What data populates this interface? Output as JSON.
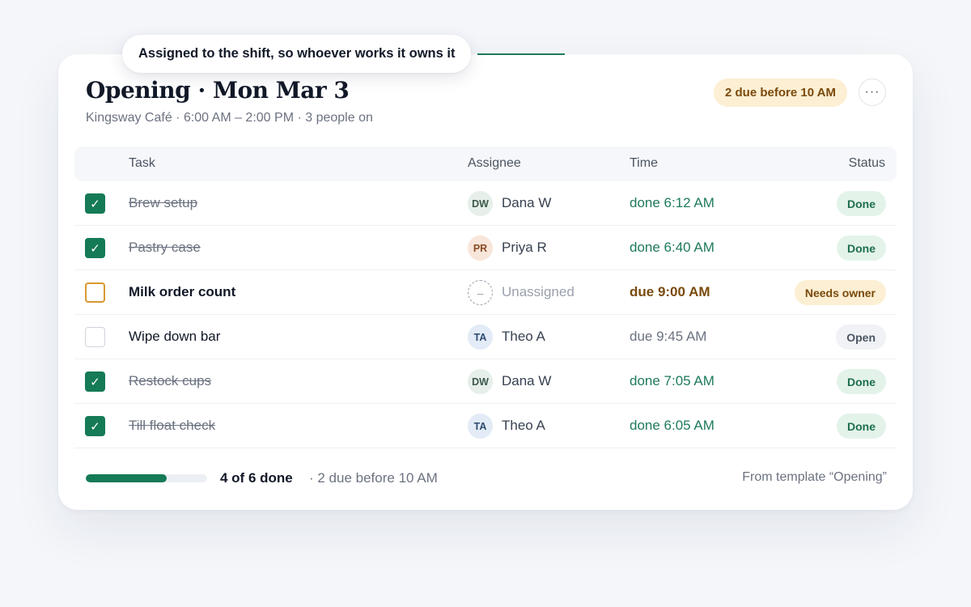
{
  "tooltip": {
    "text": "Assigned to the shift, so whoever works it owns it"
  },
  "header": {
    "title": "Opening · Mon Mar 3",
    "subtitle": "Kingsway Café · 6:00 AM – 2:00 PM · 3 people on",
    "due_badge": "2 due before 10 AM",
    "more_icon": "more-horizontal-icon",
    "more_glyph": "···"
  },
  "table": {
    "columns": {
      "task": "Task",
      "assignee": "Assignee",
      "time": "Time",
      "status": "Status"
    },
    "rows": [
      {
        "task": "Brew setup",
        "checked": true,
        "state": "done",
        "initials": "DW",
        "assignee": "Dana W",
        "avatar_bg": "#e6efe9",
        "avatar_fg": "#3d5a4c",
        "time": "done 6:12 AM",
        "status": "Done"
      },
      {
        "task": "Pastry case",
        "checked": true,
        "state": "done",
        "initials": "PR",
        "assignee": "Priya R",
        "avatar_bg": "#f8e6da",
        "avatar_fg": "#8a4a22",
        "time": "done 6:40 AM",
        "status": "Done"
      },
      {
        "task": "Milk order count",
        "checked": false,
        "state": "needs-owner",
        "initials": "–",
        "assignee": "Unassigned",
        "avatar_bg": "#ffffff",
        "avatar_fg": "#9aa1ad",
        "time": "due 9:00 AM",
        "status": "Needs owner"
      },
      {
        "task": "Wipe down bar",
        "checked": false,
        "state": "open",
        "initials": "TA",
        "assignee": "Theo A",
        "avatar_bg": "#e2ebf6",
        "avatar_fg": "#2f4a6e",
        "time": "due 9:45 AM",
        "status": "Open"
      },
      {
        "task": "Restock cups",
        "checked": true,
        "state": "done",
        "initials": "DW",
        "assignee": "Dana W",
        "avatar_bg": "#e6efe9",
        "avatar_fg": "#3d5a4c",
        "time": "done 7:05 AM",
        "status": "Done"
      },
      {
        "task": "Till float check",
        "checked": true,
        "state": "done",
        "initials": "TA",
        "assignee": "Theo A",
        "avatar_bg": "#e2ebf6",
        "avatar_fg": "#2f4a6e",
        "time": "done 6:05 AM",
        "status": "Done"
      }
    ]
  },
  "footer": {
    "progress_fraction": 0.667,
    "done_count": "4 of 6 done",
    "due_note": "· 2 due before 10 AM",
    "template_note": "From template “Opening”"
  },
  "colors": {
    "accent": "#157a56",
    "done_text": "#1e7a5a",
    "done_badge_bg": "#e3f3ea",
    "done_badge_fg": "#1e6e4e",
    "warn_badge_bg": "#fcefd3",
    "warn_badge_fg": "#7a4a0c",
    "warn_time": "#7a4a0c",
    "open_badge_bg": "#f0f2f5",
    "open_badge_fg": "#4b5563",
    "open_time": "#6b7280"
  }
}
